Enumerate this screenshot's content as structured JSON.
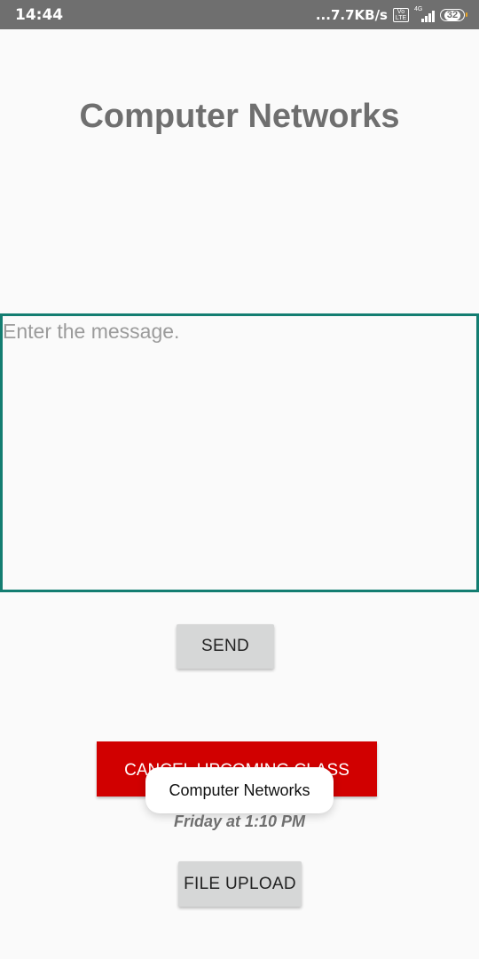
{
  "status_bar": {
    "time": "14:44",
    "network_speed": "...7.7KB/s",
    "volte_label": "Vo LTE",
    "network_type": "4G",
    "battery_level": "32"
  },
  "page": {
    "title": "Computer Networks"
  },
  "message_input": {
    "placeholder": "Enter the message.",
    "value": ""
  },
  "buttons": {
    "send_label": "SEND",
    "cancel_label": "CANCEL UPCOMING CLASS",
    "file_upload_label": "FILE UPLOAD"
  },
  "toast": {
    "text": "Computer Networks"
  },
  "class_info": {
    "time": "Friday at 1:10 PM"
  },
  "colors": {
    "status_bar": "#6f6f6f",
    "input_border": "#137d71",
    "cancel_button": "#d10000",
    "gray_button": "#d6d7d7"
  }
}
